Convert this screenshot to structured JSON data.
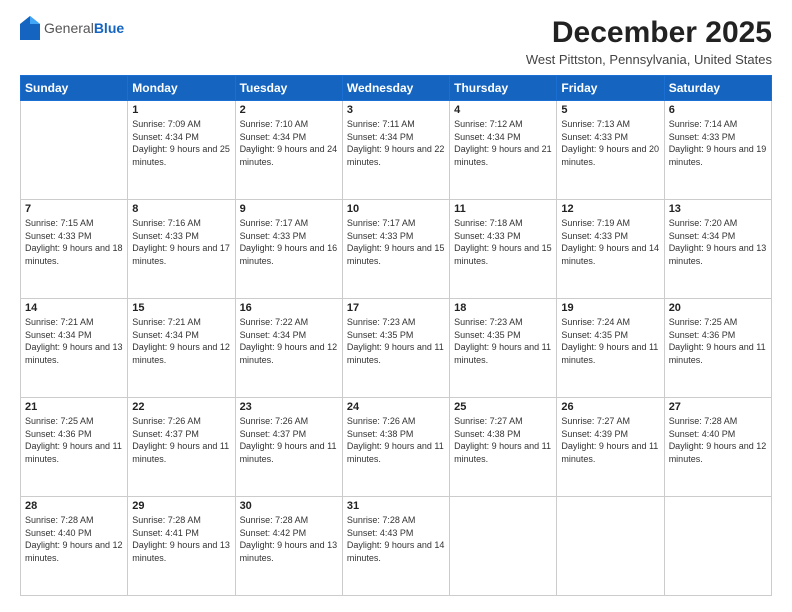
{
  "logo": {
    "general": "General",
    "blue": "Blue"
  },
  "header": {
    "month": "December 2025",
    "location": "West Pittston, Pennsylvania, United States"
  },
  "weekdays": [
    "Sunday",
    "Monday",
    "Tuesday",
    "Wednesday",
    "Thursday",
    "Friday",
    "Saturday"
  ],
  "weeks": [
    [
      {
        "day": "",
        "sunrise": "",
        "sunset": "",
        "daylight": ""
      },
      {
        "day": "1",
        "sunrise": "Sunrise: 7:09 AM",
        "sunset": "Sunset: 4:34 PM",
        "daylight": "Daylight: 9 hours and 25 minutes."
      },
      {
        "day": "2",
        "sunrise": "Sunrise: 7:10 AM",
        "sunset": "Sunset: 4:34 PM",
        "daylight": "Daylight: 9 hours and 24 minutes."
      },
      {
        "day": "3",
        "sunrise": "Sunrise: 7:11 AM",
        "sunset": "Sunset: 4:34 PM",
        "daylight": "Daylight: 9 hours and 22 minutes."
      },
      {
        "day": "4",
        "sunrise": "Sunrise: 7:12 AM",
        "sunset": "Sunset: 4:34 PM",
        "daylight": "Daylight: 9 hours and 21 minutes."
      },
      {
        "day": "5",
        "sunrise": "Sunrise: 7:13 AM",
        "sunset": "Sunset: 4:33 PM",
        "daylight": "Daylight: 9 hours and 20 minutes."
      },
      {
        "day": "6",
        "sunrise": "Sunrise: 7:14 AM",
        "sunset": "Sunset: 4:33 PM",
        "daylight": "Daylight: 9 hours and 19 minutes."
      }
    ],
    [
      {
        "day": "7",
        "sunrise": "Sunrise: 7:15 AM",
        "sunset": "Sunset: 4:33 PM",
        "daylight": "Daylight: 9 hours and 18 minutes."
      },
      {
        "day": "8",
        "sunrise": "Sunrise: 7:16 AM",
        "sunset": "Sunset: 4:33 PM",
        "daylight": "Daylight: 9 hours and 17 minutes."
      },
      {
        "day": "9",
        "sunrise": "Sunrise: 7:17 AM",
        "sunset": "Sunset: 4:33 PM",
        "daylight": "Daylight: 9 hours and 16 minutes."
      },
      {
        "day": "10",
        "sunrise": "Sunrise: 7:17 AM",
        "sunset": "Sunset: 4:33 PM",
        "daylight": "Daylight: 9 hours and 15 minutes."
      },
      {
        "day": "11",
        "sunrise": "Sunrise: 7:18 AM",
        "sunset": "Sunset: 4:33 PM",
        "daylight": "Daylight: 9 hours and 15 minutes."
      },
      {
        "day": "12",
        "sunrise": "Sunrise: 7:19 AM",
        "sunset": "Sunset: 4:33 PM",
        "daylight": "Daylight: 9 hours and 14 minutes."
      },
      {
        "day": "13",
        "sunrise": "Sunrise: 7:20 AM",
        "sunset": "Sunset: 4:34 PM",
        "daylight": "Daylight: 9 hours and 13 minutes."
      }
    ],
    [
      {
        "day": "14",
        "sunrise": "Sunrise: 7:21 AM",
        "sunset": "Sunset: 4:34 PM",
        "daylight": "Daylight: 9 hours and 13 minutes."
      },
      {
        "day": "15",
        "sunrise": "Sunrise: 7:21 AM",
        "sunset": "Sunset: 4:34 PM",
        "daylight": "Daylight: 9 hours and 12 minutes."
      },
      {
        "day": "16",
        "sunrise": "Sunrise: 7:22 AM",
        "sunset": "Sunset: 4:34 PM",
        "daylight": "Daylight: 9 hours and 12 minutes."
      },
      {
        "day": "17",
        "sunrise": "Sunrise: 7:23 AM",
        "sunset": "Sunset: 4:35 PM",
        "daylight": "Daylight: 9 hours and 11 minutes."
      },
      {
        "day": "18",
        "sunrise": "Sunrise: 7:23 AM",
        "sunset": "Sunset: 4:35 PM",
        "daylight": "Daylight: 9 hours and 11 minutes."
      },
      {
        "day": "19",
        "sunrise": "Sunrise: 7:24 AM",
        "sunset": "Sunset: 4:35 PM",
        "daylight": "Daylight: 9 hours and 11 minutes."
      },
      {
        "day": "20",
        "sunrise": "Sunrise: 7:25 AM",
        "sunset": "Sunset: 4:36 PM",
        "daylight": "Daylight: 9 hours and 11 minutes."
      }
    ],
    [
      {
        "day": "21",
        "sunrise": "Sunrise: 7:25 AM",
        "sunset": "Sunset: 4:36 PM",
        "daylight": "Daylight: 9 hours and 11 minutes."
      },
      {
        "day": "22",
        "sunrise": "Sunrise: 7:26 AM",
        "sunset": "Sunset: 4:37 PM",
        "daylight": "Daylight: 9 hours and 11 minutes."
      },
      {
        "day": "23",
        "sunrise": "Sunrise: 7:26 AM",
        "sunset": "Sunset: 4:37 PM",
        "daylight": "Daylight: 9 hours and 11 minutes."
      },
      {
        "day": "24",
        "sunrise": "Sunrise: 7:26 AM",
        "sunset": "Sunset: 4:38 PM",
        "daylight": "Daylight: 9 hours and 11 minutes."
      },
      {
        "day": "25",
        "sunrise": "Sunrise: 7:27 AM",
        "sunset": "Sunset: 4:38 PM",
        "daylight": "Daylight: 9 hours and 11 minutes."
      },
      {
        "day": "26",
        "sunrise": "Sunrise: 7:27 AM",
        "sunset": "Sunset: 4:39 PM",
        "daylight": "Daylight: 9 hours and 11 minutes."
      },
      {
        "day": "27",
        "sunrise": "Sunrise: 7:28 AM",
        "sunset": "Sunset: 4:40 PM",
        "daylight": "Daylight: 9 hours and 12 minutes."
      }
    ],
    [
      {
        "day": "28",
        "sunrise": "Sunrise: 7:28 AM",
        "sunset": "Sunset: 4:40 PM",
        "daylight": "Daylight: 9 hours and 12 minutes."
      },
      {
        "day": "29",
        "sunrise": "Sunrise: 7:28 AM",
        "sunset": "Sunset: 4:41 PM",
        "daylight": "Daylight: 9 hours and 13 minutes."
      },
      {
        "day": "30",
        "sunrise": "Sunrise: 7:28 AM",
        "sunset": "Sunset: 4:42 PM",
        "daylight": "Daylight: 9 hours and 13 minutes."
      },
      {
        "day": "31",
        "sunrise": "Sunrise: 7:28 AM",
        "sunset": "Sunset: 4:43 PM",
        "daylight": "Daylight: 9 hours and 14 minutes."
      },
      {
        "day": "",
        "sunrise": "",
        "sunset": "",
        "daylight": ""
      },
      {
        "day": "",
        "sunrise": "",
        "sunset": "",
        "daylight": ""
      },
      {
        "day": "",
        "sunrise": "",
        "sunset": "",
        "daylight": ""
      }
    ]
  ]
}
